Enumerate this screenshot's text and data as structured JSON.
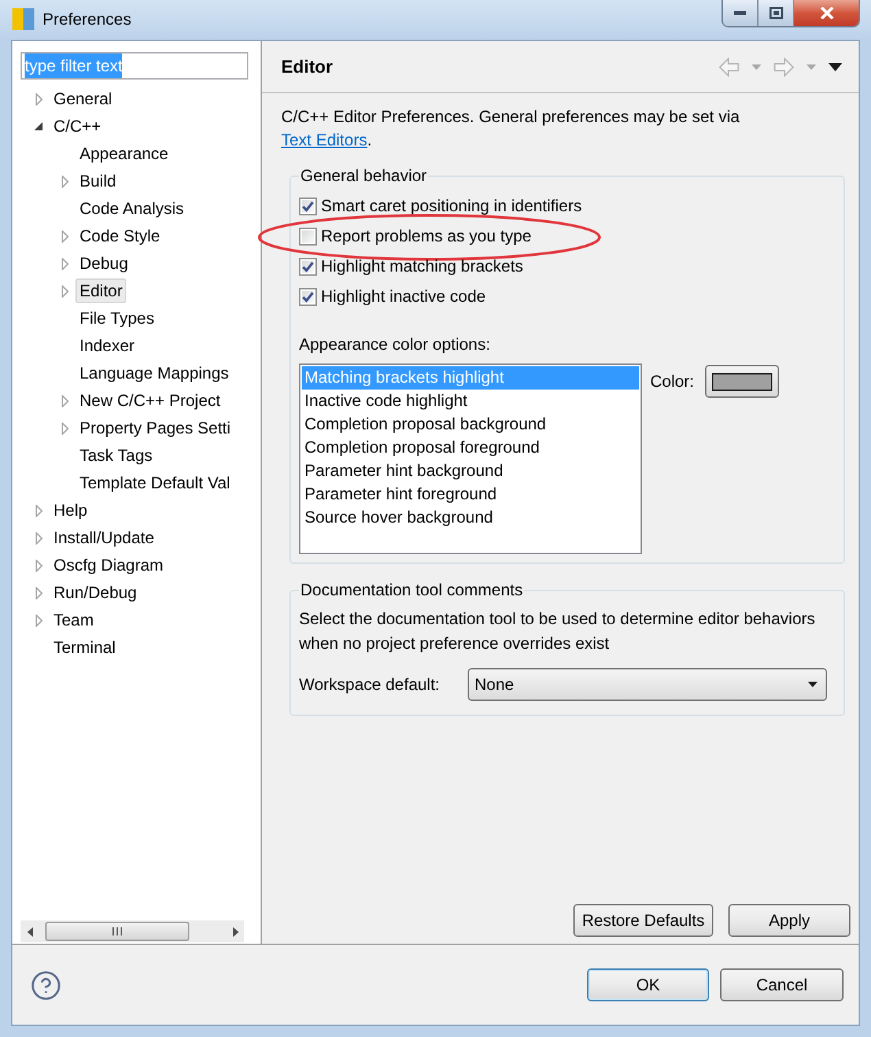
{
  "window": {
    "title": "Preferences"
  },
  "filter": {
    "value": "type filter text",
    "text_highlighted": true
  },
  "tree": [
    {
      "label": "General",
      "expanded": false,
      "selected": false
    },
    {
      "label": "C/C++",
      "expanded": true,
      "selected": false,
      "children": [
        {
          "label": "Appearance",
          "selected": false
        },
        {
          "label": "Build",
          "expanded": false,
          "selected": false
        },
        {
          "label": "Code Analysis",
          "selected": false
        },
        {
          "label": "Code Style",
          "expanded": false,
          "selected": false
        },
        {
          "label": "Debug",
          "expanded": false,
          "selected": false
        },
        {
          "label": "Editor",
          "expanded": false,
          "selected": true
        },
        {
          "label": "File Types",
          "selected": false
        },
        {
          "label": "Indexer",
          "selected": false
        },
        {
          "label": "Language Mappings",
          "selected": false
        },
        {
          "label": "New C/C++ Project",
          "expanded": false,
          "selected": false
        },
        {
          "label": "Property Pages Setti",
          "expanded": false,
          "selected": false
        },
        {
          "label": "Task Tags",
          "selected": false
        },
        {
          "label": "Template Default Val",
          "selected": false
        }
      ]
    },
    {
      "label": "Help",
      "expanded": false,
      "selected": false
    },
    {
      "label": "Install/Update",
      "expanded": false,
      "selected": false
    },
    {
      "label": "Oscfg Diagram",
      "expanded": false,
      "selected": false
    },
    {
      "label": "Run/Debug",
      "expanded": false,
      "selected": false
    },
    {
      "label": "Team",
      "expanded": false,
      "selected": false
    },
    {
      "label": "Terminal",
      "selected": false
    }
  ],
  "page": {
    "title": "Editor",
    "toolbar": [
      {
        "kind": "back",
        "disabled": true
      },
      {
        "kind": "dropdown",
        "disabled": true
      },
      {
        "kind": "forward",
        "disabled": true
      },
      {
        "kind": "dropdown",
        "disabled": true
      },
      {
        "kind": "menu",
        "disabled": false
      }
    ]
  },
  "description": {
    "text": "C/C++ Editor Preferences. General preferences may be set via",
    "link": "Text Editors",
    "end": "."
  },
  "general_behavior": {
    "title": "General behavior",
    "options": [
      {
        "label": "Smart caret positioning in identifiers",
        "checked": true,
        "circled": false
      },
      {
        "label": "Report problems as you type",
        "checked": false,
        "circled": true
      },
      {
        "label": "Highlight matching brackets",
        "checked": true,
        "circled": false
      },
      {
        "label": "Highlight inactive code",
        "checked": true,
        "circled": false
      }
    ],
    "appearance_label": "Appearance color options:",
    "color_items": [
      {
        "label": "Matching brackets highlight",
        "selected": true
      },
      {
        "label": "Inactive code highlight",
        "selected": false
      },
      {
        "label": "Completion proposal background",
        "selected": false
      },
      {
        "label": "Completion proposal foreground",
        "selected": false
      },
      {
        "label": "Parameter hint background",
        "selected": false
      },
      {
        "label": "Parameter hint foreground",
        "selected": false
      },
      {
        "label": "Source hover background",
        "selected": false
      }
    ],
    "color_label": "Color:",
    "color": "#a0a0a0"
  },
  "documentation": {
    "title": "Documentation tool comments",
    "text": "Select the documentation tool to be used to determine editor behaviors when no project preference overrides exist",
    "field_label": "Workspace default:",
    "value": "None"
  },
  "page_buttons": [
    "Restore Defaults",
    "Apply"
  ],
  "dialog_buttons": [
    {
      "label": "OK",
      "default": true
    },
    {
      "label": "Cancel",
      "default": false
    }
  ]
}
